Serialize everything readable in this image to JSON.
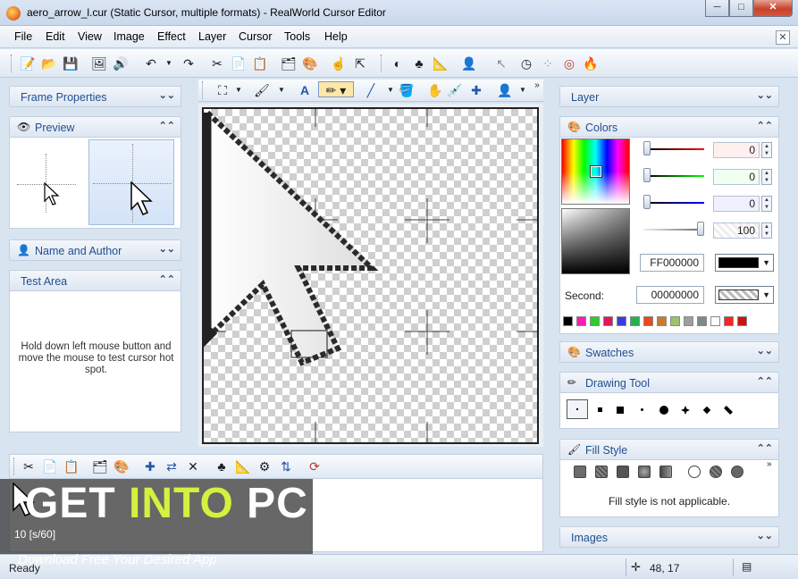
{
  "window": {
    "title": "aero_arrow_l.cur (Static Cursor, multiple formats) - RealWorld Cursor Editor",
    "minimize": "─",
    "maximize": "□",
    "close": "✕",
    "mdi_close": "✕"
  },
  "menu": [
    "File",
    "Edit",
    "View",
    "Image",
    "Effect",
    "Layer",
    "Cursor",
    "Tools",
    "Help"
  ],
  "left_panels": {
    "frame_properties": "Frame Properties",
    "preview": "Preview",
    "name_and_author": "Name and Author",
    "test_area": "Test Area",
    "test_area_text": "Hold down left mouse button and move the mouse to test cursor hot spot."
  },
  "right_panels": {
    "layer": "Layer",
    "colors": "Colors",
    "swatches": "Swatches",
    "drawing_tool": "Drawing Tool",
    "fill_style": "Fill Style",
    "fill_style_note": "Fill style is not applicable.",
    "images": "Images",
    "red_value": "0",
    "green_value": "0",
    "blue_value": "0",
    "alpha_value": "100",
    "primary_hex": "FF000000",
    "second_label": "Second:",
    "second_hex": "00000000",
    "palette": [
      "#000000",
      "#ff1ab3",
      "#2ecc2e",
      "#e0175a",
      "#3a3adf",
      "#22b34a",
      "#e64a19",
      "#c77d2b",
      "#9cc26b",
      "#9e9e9e",
      "#7e8a8a",
      "#ffffff",
      "#ff2222",
      "#cc1111"
    ]
  },
  "bottom": {
    "frame_label": "10 [s/60]"
  },
  "watermark": {
    "get": "GET ",
    "into": "INTO",
    "pc": " PC",
    "sub": "Download Free Your Desired App"
  },
  "status": {
    "ready": "Ready",
    "coords": "48, 17"
  },
  "colors": {
    "accent_text": "#1f4f8f",
    "panel_bg": "#d9e4f1"
  }
}
